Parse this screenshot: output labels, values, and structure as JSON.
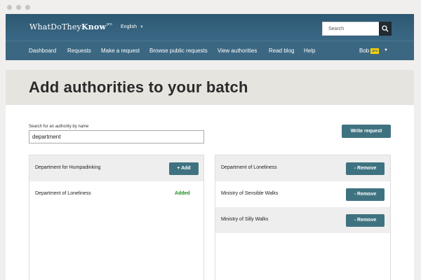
{
  "header": {
    "logo_prefix": "WhatDoThey",
    "logo_bold": "Know",
    "logo_sup": "pro",
    "language": "English",
    "search_placeholder": "Search"
  },
  "nav": {
    "items": [
      "Dashboard",
      "Requests",
      "Make a request",
      "Browse public requests",
      "View authorities",
      "Read blog",
      "Help"
    ],
    "user_name": "Bob",
    "user_badge": "pro"
  },
  "page": {
    "title": "Add authorities to your batch",
    "search_label": "Search for an authority by name",
    "search_value": "department",
    "write_request_label": "Write request"
  },
  "search_results": [
    {
      "name": "Department for Humpadinking",
      "action": "+ Add"
    },
    {
      "name": "Department of Loneliness",
      "status": "Added"
    }
  ],
  "batch": [
    {
      "name": "Department of Loneliness",
      "action": "- Remove"
    },
    {
      "name": "Ministry of Sensible Walks",
      "action": "- Remove"
    },
    {
      "name": "Ministry of Silly Walks",
      "action": "- Remove"
    }
  ],
  "colors": {
    "header_bg": "#36607a",
    "button_bg": "#3f7280",
    "added_text": "#22891f",
    "pro_badge": "#ffd400"
  }
}
